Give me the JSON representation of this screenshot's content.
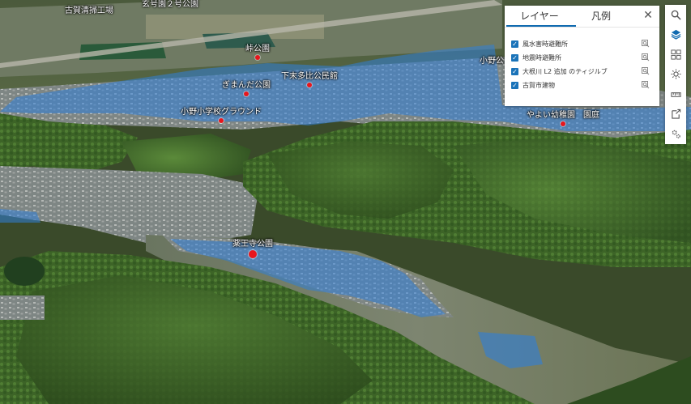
{
  "map": {
    "places": [
      {
        "id": "furuga-seisou",
        "label": "古賀清掃工場",
        "marker": false
      },
      {
        "id": "gengo-park",
        "label": "玄号園２号公園",
        "marker": false
      },
      {
        "id": "toge-park",
        "label": "峠公園",
        "marker": true
      },
      {
        "id": "ono-park",
        "label": "小野公",
        "marker": false
      },
      {
        "id": "shimosuehi-hall",
        "label": "下末多比公民館",
        "marker": true
      },
      {
        "id": "gomanda-park",
        "label": "ぎまんだ公園",
        "marker": true
      },
      {
        "id": "ono-school-ground",
        "label": "小野小学校グラウンド",
        "marker": true
      },
      {
        "id": "yayoi-kindergarten",
        "label": "やよい幼稚園　園庭",
        "marker": true
      },
      {
        "id": "yakuoji-park",
        "label": "薬王寺公園",
        "marker": true
      }
    ]
  },
  "layer_panel": {
    "tab_layers": "レイヤー",
    "tab_legend": "凡例",
    "active_tab": "layers",
    "layers": [
      {
        "name": "風水害時避難所",
        "checked": true
      },
      {
        "name": "地震時避難所",
        "checked": true
      },
      {
        "name": "大根川 L2 追加 のティジルブ",
        "checked": true
      },
      {
        "name": "古賀市建物",
        "checked": true
      }
    ]
  },
  "toolbar": {
    "tools": [
      "search-icon",
      "layers-icon",
      "basemap-gallery-icon",
      "daylight-icon",
      "measure-icon",
      "share-icon",
      "settings-icon"
    ],
    "active": "layers-icon"
  },
  "colors": {
    "flood_zone": "#2f7fd8",
    "marker": "#e8161c",
    "accent": "#0f6ab0"
  }
}
